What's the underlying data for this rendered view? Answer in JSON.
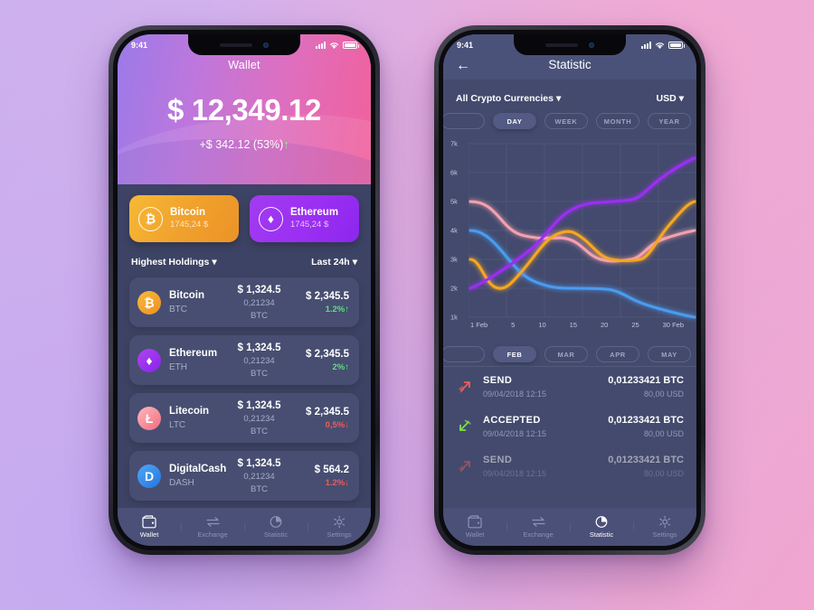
{
  "background": {
    "from": "#cdb0ee",
    "to": "#f0a6cf"
  },
  "phone1": {
    "status": {
      "time": "9:41"
    },
    "header": {
      "title": "Wallet",
      "amount": "$ 12,349.12",
      "delta": "+$ 342.12 (53%)",
      "delta_arrow": "↑",
      "delta_color": "#7dff8e",
      "gradient_from": "#9b7ae8",
      "gradient_to": "#f2609a"
    },
    "quick_cards": [
      {
        "name": "Bitcoin",
        "price": "1745,24 $",
        "symbol": "₿",
        "icon": "bitcoin-icon",
        "color": "#f0a02c"
      },
      {
        "name": "Ethereum",
        "price": "1745,24 $",
        "symbol": "♦",
        "icon": "ethereum-icon",
        "color": "#9b2ff2"
      }
    ],
    "filters": {
      "sort": "Highest Holdings",
      "period": "Last 24h",
      "caret": "▾"
    },
    "coins": [
      {
        "name": "Bitcoin",
        "symbol": "BTC",
        "price": "$ 1,324.5",
        "amount": "0,21234 BTC",
        "value": "$ 2,345.5",
        "change": "1.2%",
        "dir": "up",
        "arrow": "↑",
        "icon": "bitcoin-icon",
        "glyph": "₿"
      },
      {
        "name": "Ethereum",
        "symbol": "ETH",
        "price": "$ 1,324.5",
        "amount": "0,21234 BTC",
        "value": "$ 2,345.5",
        "change": "2%",
        "dir": "up",
        "arrow": "↑",
        "icon": "ethereum-icon",
        "glyph": "♦"
      },
      {
        "name": "Litecoin",
        "symbol": "LTC",
        "price": "$ 1,324.5",
        "amount": "0,21234 BTC",
        "value": "$ 2,345.5",
        "change": "0,5%",
        "dir": "down",
        "arrow": "↓",
        "icon": "litecoin-icon",
        "glyph": "Ł"
      },
      {
        "name": "DigitalCash",
        "symbol": "DASH",
        "price": "$ 1,324.5",
        "amount": "0,21234 BTC",
        "value": "$ 564.2",
        "change": "1.2%",
        "dir": "down",
        "arrow": "↓",
        "icon": "dash-icon",
        "glyph": "D"
      }
    ],
    "tabs": [
      {
        "label": "Wallet",
        "icon": "wallet-icon",
        "active": true
      },
      {
        "label": "Exchange",
        "icon": "exchange-icon",
        "active": false
      },
      {
        "label": "Statistic",
        "icon": "statistic-icon",
        "active": false
      },
      {
        "label": "Settings",
        "icon": "settings-icon",
        "active": false
      }
    ]
  },
  "phone2": {
    "status": {
      "time": "9:41"
    },
    "header": {
      "title": "Statistic",
      "back_icon": "back-arrow-icon"
    },
    "filters": {
      "currencies": "All Crypto Currencies",
      "fiat": "USD",
      "caret": "▾"
    },
    "ranges": [
      {
        "label": "DAY",
        "active": true
      },
      {
        "label": "WEEK",
        "active": false
      },
      {
        "label": "MONTH",
        "active": false
      },
      {
        "label": "YEAR",
        "active": false
      }
    ],
    "months": [
      {
        "label": "FEB",
        "active": true
      },
      {
        "label": "MAR",
        "active": false
      },
      {
        "label": "APR",
        "active": false
      },
      {
        "label": "MAY",
        "active": false
      }
    ],
    "transactions": [
      {
        "type": "SEND",
        "date": "09/04/2018 12:15",
        "amount": "0,01233421 BTC",
        "fiat": "80,00 USD",
        "icon": "send-arrow-icon",
        "color": "#ef5b5b"
      },
      {
        "type": "ACCEPTED",
        "date": "09/04/2018 12:15",
        "amount": "0,01233421 BTC",
        "fiat": "80,00 USD",
        "icon": "accepted-arrow-icon",
        "color": "#7ee03f"
      },
      {
        "type": "SEND",
        "date": "09/04/2018 12:15",
        "amount": "0,01233421 BTC",
        "fiat": "80,00 USD",
        "icon": "send-arrow-icon",
        "color": "#ef5b5b"
      }
    ],
    "tabs": [
      {
        "label": "Wallet",
        "icon": "wallet-icon",
        "active": false
      },
      {
        "label": "Exchange",
        "icon": "exchange-icon",
        "active": false
      },
      {
        "label": "Statistic",
        "icon": "statistic-icon",
        "active": true
      },
      {
        "label": "Settings",
        "icon": "settings-icon",
        "active": false
      }
    ]
  },
  "chart_data": {
    "type": "line",
    "title": "Statistic",
    "xlabel": "",
    "ylabel": "",
    "x": [
      1,
      5,
      10,
      15,
      20,
      25,
      30
    ],
    "tick_labels_x": [
      "1 Feb",
      "5",
      "10",
      "15",
      "20",
      "25",
      "30 Feb"
    ],
    "tick_labels_y": [
      "7k",
      "6k",
      "5k",
      "4k",
      "3k",
      "2k",
      "1k"
    ],
    "ylim": [
      1000,
      7000
    ],
    "grid": true,
    "legend": "none",
    "series": [
      {
        "name": "Pink",
        "color": "#f4a0ae",
        "values": [
          5000,
          4800,
          4150,
          3750,
          3200,
          3050,
          3450,
          4000
        ]
      },
      {
        "name": "Blue",
        "color": "#4a9cf0",
        "values": [
          4000,
          3700,
          2750,
          2200,
          2000,
          1950,
          1600,
          1050
        ]
      },
      {
        "name": "Orange",
        "color": "#f5a623",
        "values": [
          3000,
          2050,
          2700,
          3900,
          4000,
          3350,
          3050,
          5000
        ]
      },
      {
        "name": "Purple",
        "color": "#9b2ff2",
        "values": [
          2000,
          2450,
          2900,
          3700,
          4900,
          5050,
          5250,
          6000
        ]
      }
    ]
  }
}
